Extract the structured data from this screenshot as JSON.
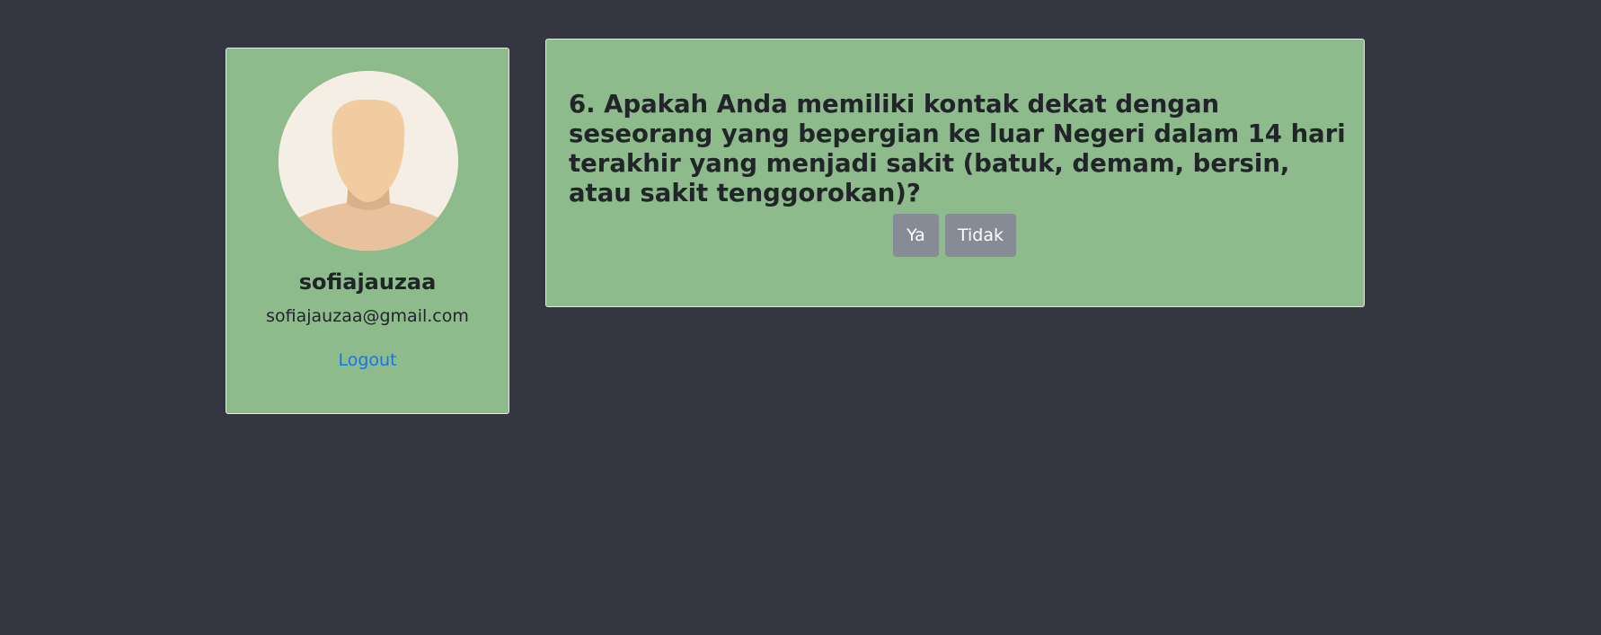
{
  "profile": {
    "avatar_icon": "user-avatar-placeholder",
    "username": "sofiajauzaa",
    "email": "sofiajauzaa@gmail.com",
    "logout_label": "Logout"
  },
  "question": {
    "text": "6. Apakah Anda memiliki kontak dekat dengan seseorang yang bepergian ke luar Negeri dalam 14 hari terakhir yang menjadi sakit (batuk, demam, bersin, atau sakit tenggorokan)?",
    "answers": {
      "yes_label": "Ya",
      "no_label": "Tidak"
    }
  },
  "colors": {
    "background": "#343741",
    "card": "#8dbb8b",
    "button": "#868b96",
    "link": "#1a73e8"
  }
}
